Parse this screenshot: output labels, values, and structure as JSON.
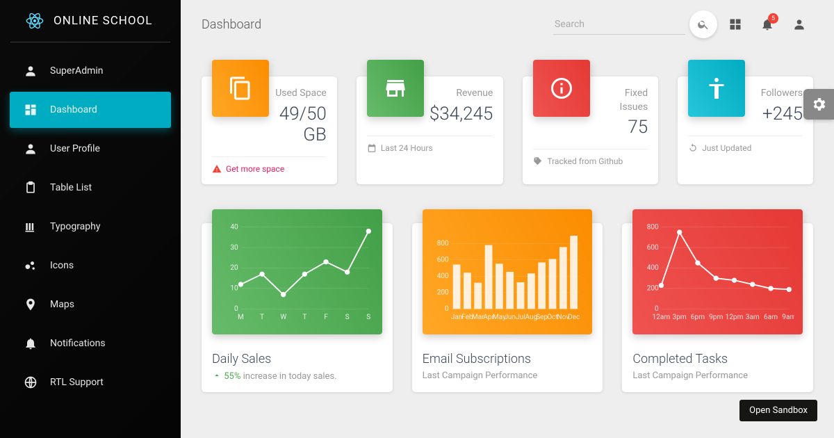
{
  "brand": "ONLINE SCHOOL",
  "page_title": "Dashboard",
  "search": {
    "placeholder": "Search"
  },
  "notification_count": "5",
  "sidebar": {
    "items": [
      {
        "label": "SuperAdmin"
      },
      {
        "label": "Dashboard"
      },
      {
        "label": "User Profile"
      },
      {
        "label": "Table List"
      },
      {
        "label": "Typography"
      },
      {
        "label": "Icons"
      },
      {
        "label": "Maps"
      },
      {
        "label": "Notifications"
      },
      {
        "label": "RTL Support"
      }
    ]
  },
  "stats": [
    {
      "label": "Used Space",
      "value": "49/50 GB",
      "footer": "Get more space",
      "footer_type": "link"
    },
    {
      "label": "Revenue",
      "value": "$34,245",
      "footer": "Last 24 Hours",
      "footer_type": "text"
    },
    {
      "label": "Fixed Issues",
      "value": "75",
      "footer": "Tracked from Github",
      "footer_type": "text"
    },
    {
      "label": "Followers",
      "value": "+245",
      "footer": "Just Updated",
      "footer_type": "text"
    }
  ],
  "charts": [
    {
      "title": "Daily Sales",
      "sub_pre": "",
      "sub_highlight": "55%",
      "sub_post": " increase in today sales."
    },
    {
      "title": "Email Subscriptions",
      "sub": "Last Campaign Performance"
    },
    {
      "title": "Completed Tasks",
      "sub": "Last Campaign Performance"
    }
  ],
  "chart_data": [
    {
      "type": "line",
      "categories": [
        "M",
        "T",
        "W",
        "T",
        "F",
        "S",
        "S"
      ],
      "values": [
        12,
        17,
        7,
        17,
        23,
        18,
        38
      ],
      "ylim": [
        0,
        40
      ],
      "yticks": [
        0,
        10,
        20,
        30,
        40
      ]
    },
    {
      "type": "bar",
      "categories": [
        "Jan",
        "Feb",
        "Mar",
        "Apr",
        "May",
        "Jun",
        "Jul",
        "Aug",
        "Sep",
        "Oct",
        "Nov",
        "Dec"
      ],
      "values": [
        542,
        443,
        320,
        780,
        553,
        453,
        326,
        434,
        568,
        610,
        756,
        895
      ],
      "ylim": [
        0,
        1000
      ],
      "yticks": [
        0,
        200,
        400,
        600,
        800
      ]
    },
    {
      "type": "line",
      "categories": [
        "12am",
        "3pm",
        "6pm",
        "9pm",
        "12pm",
        "3am",
        "6am",
        "9am"
      ],
      "values": [
        230,
        750,
        450,
        300,
        280,
        240,
        200,
        190
      ],
      "ylim": [
        0,
        800
      ],
      "yticks": [
        0,
        200,
        400,
        600,
        800
      ]
    }
  ],
  "sandbox_btn": "Open Sandbox"
}
